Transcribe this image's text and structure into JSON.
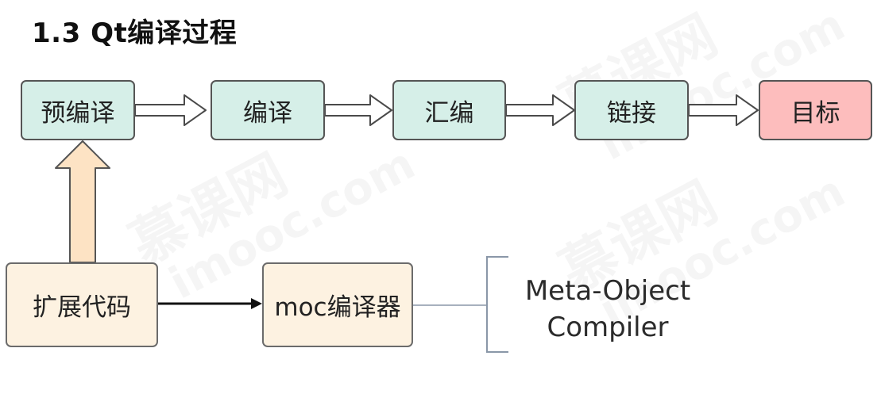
{
  "title": "1.3 Qt编译过程",
  "flow": {
    "stages": [
      "预编译",
      "编译",
      "汇编",
      "链接",
      "目标"
    ],
    "extension_code": "扩展代码",
    "moc_compiler": "moc编译器",
    "note": {
      "line1": "Meta-Object",
      "line2": "Compiler"
    }
  },
  "watermark": {
    "brand": "慕课网",
    "site": "imooc.com"
  },
  "colors": {
    "stage_fill": "#d6efe8",
    "target_fill": "#fdbdbd",
    "cream_fill": "#fdf2e1",
    "up_arrow_fill": "#fde3c4"
  }
}
